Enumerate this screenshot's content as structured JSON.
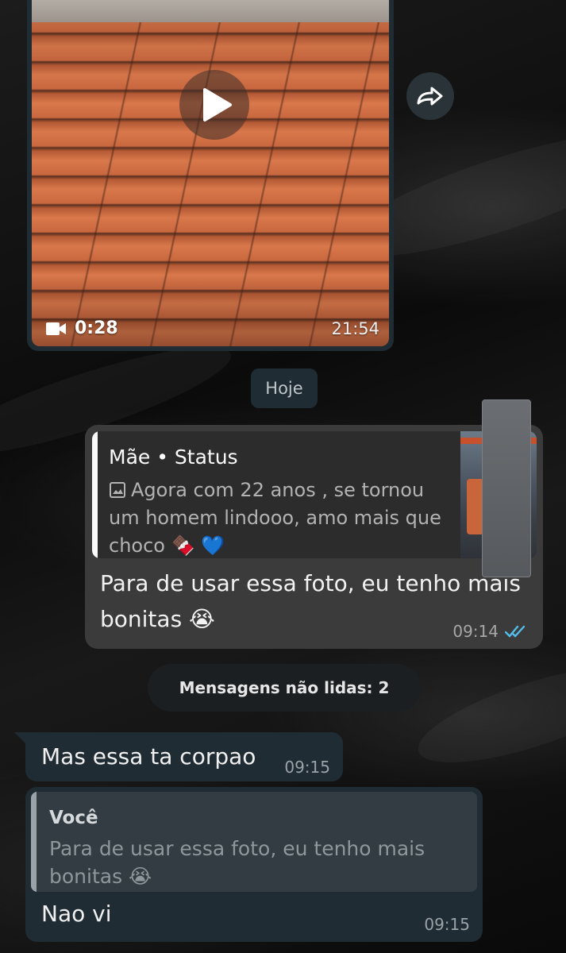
{
  "video_message": {
    "duration": "0:28",
    "time": "21:54"
  },
  "date_separator": "Hoje",
  "outgoing_message": {
    "status_reply": {
      "author": "Mãe • Status",
      "caption": "Agora com 22 anos , se tornou um homem lindooo, amo mais que choco 🍫 💙"
    },
    "text": "Para de usar essa foto, eu tenho mais bonitas 😭",
    "time": "09:14",
    "read_status": "read"
  },
  "unread_banner": "Mensagens não lidas: 2",
  "incoming_messages": [
    {
      "text": "Mas essa ta corpao",
      "time": "09:15"
    },
    {
      "reply_to": {
        "author": "Você",
        "text": "Para de usar essa foto, eu tenho mais bonitas 😭"
      },
      "text": "Nao vi",
      "time": "09:15"
    }
  ],
  "colors": {
    "bubble_incoming": "#202c33",
    "bubble_outgoing": "#3b3b3b",
    "read_ticks": "#53bdeb"
  }
}
